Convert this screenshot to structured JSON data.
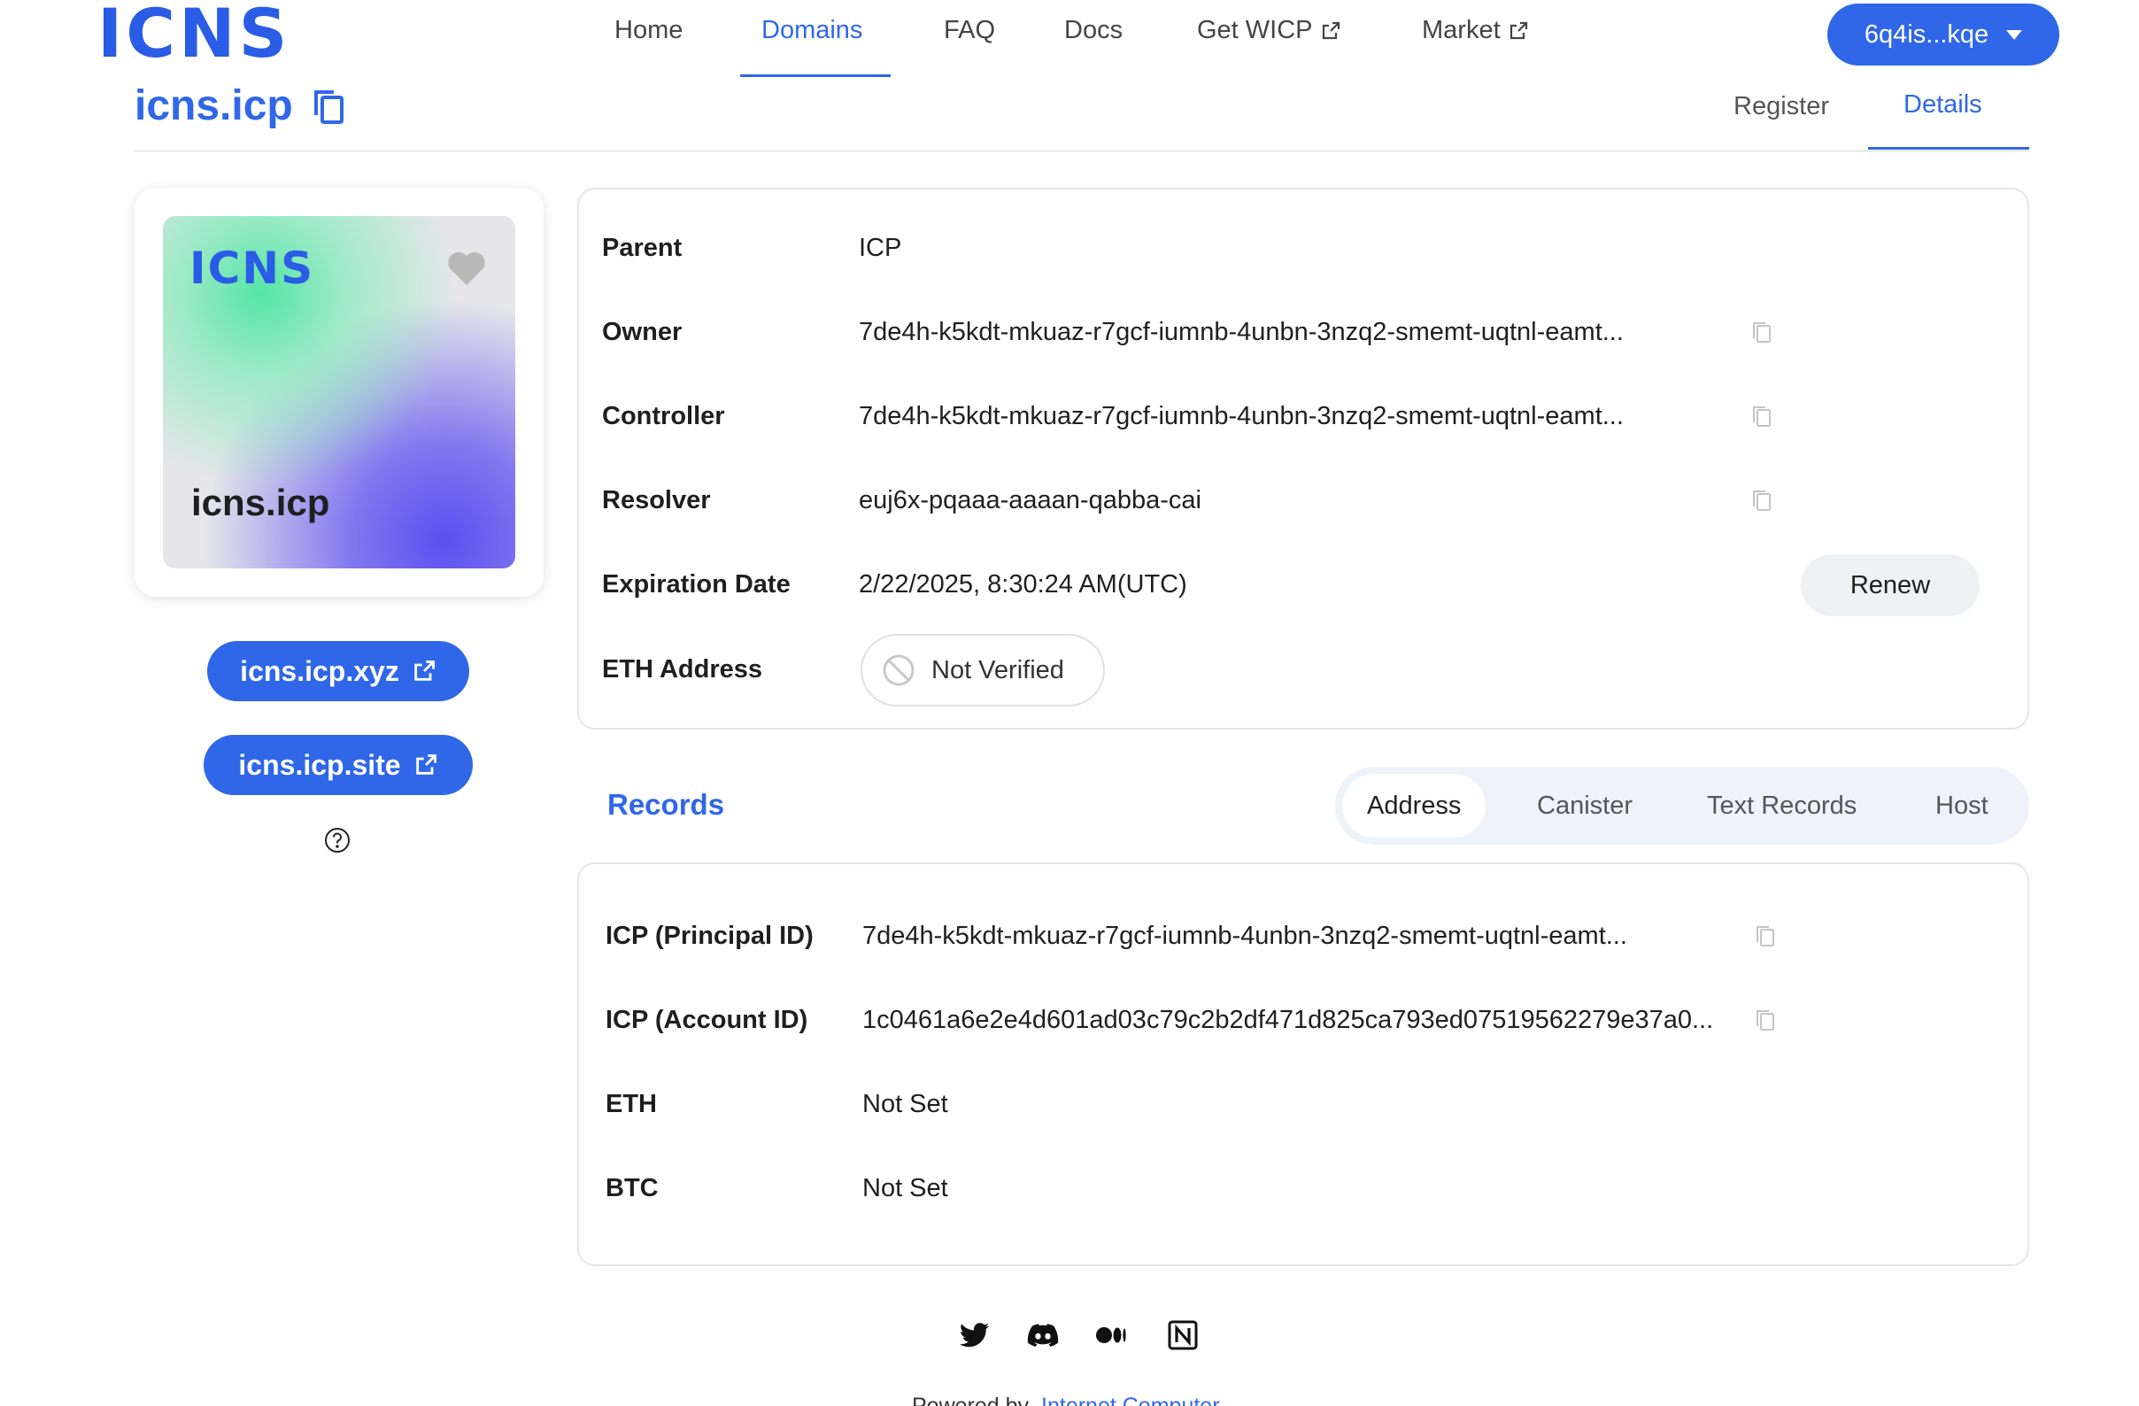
{
  "brand": {
    "logo_text": "ICNS",
    "accent": "#2f67e8"
  },
  "nav": {
    "items": [
      {
        "label": "Home"
      },
      {
        "label": "Domains"
      },
      {
        "label": "FAQ"
      },
      {
        "label": "Docs"
      },
      {
        "label": "Get WICP"
      },
      {
        "label": "Market"
      }
    ],
    "active": "Domains",
    "account_label": "6q4is...kqe"
  },
  "domain": {
    "name": "icns.icp",
    "tabs": [
      {
        "label": "Register"
      },
      {
        "label": "Details"
      }
    ],
    "active_tab": "Details"
  },
  "card": {
    "logo_text": "ICNS",
    "name": "icns.icp",
    "links": [
      {
        "label": "icns.icp.xyz"
      },
      {
        "label": "icns.icp.site"
      }
    ]
  },
  "details": {
    "rows": [
      {
        "label": "Parent",
        "value": "ICP"
      },
      {
        "label": "Owner",
        "value": "7de4h-k5kdt-mkuaz-r7gcf-iumnb-4unbn-3nzq2-smemt-uqtnl-eamt..."
      },
      {
        "label": "Controller",
        "value": "7de4h-k5kdt-mkuaz-r7gcf-iumnb-4unbn-3nzq2-smemt-uqtnl-eamt..."
      },
      {
        "label": "Resolver",
        "value": "euj6x-pqaaa-aaaan-qabba-cai"
      },
      {
        "label": "Expiration Date",
        "value": "2/22/2025, 8:30:24 AM(UTC)"
      },
      {
        "label": "ETH Address",
        "value": "Not Verified"
      }
    ],
    "renew_label": "Renew"
  },
  "records": {
    "title": "Records",
    "tabs": [
      {
        "label": "Address"
      },
      {
        "label": "Canister"
      },
      {
        "label": "Text Records"
      },
      {
        "label": "Host"
      }
    ],
    "active_tab": "Address",
    "rows": [
      {
        "label": "ICP (Principal ID)",
        "value": "7de4h-k5kdt-mkuaz-r7gcf-iumnb-4unbn-3nzq2-smemt-uqtnl-eamt..."
      },
      {
        "label": "ICP (Account ID)",
        "value": "1c0461a6e2e4d601ad03c79c2b2df471d825ca793ed07519562279e37a0..."
      },
      {
        "label": "ETH",
        "value": "Not Set"
      },
      {
        "label": "BTC",
        "value": "Not Set"
      }
    ]
  },
  "footer": {
    "social_icons": [
      "twitter-icon",
      "discord-icon",
      "medium-icon",
      "notion-icon"
    ],
    "powered_by": "Powered by",
    "powered_link": "Internet Computer"
  }
}
